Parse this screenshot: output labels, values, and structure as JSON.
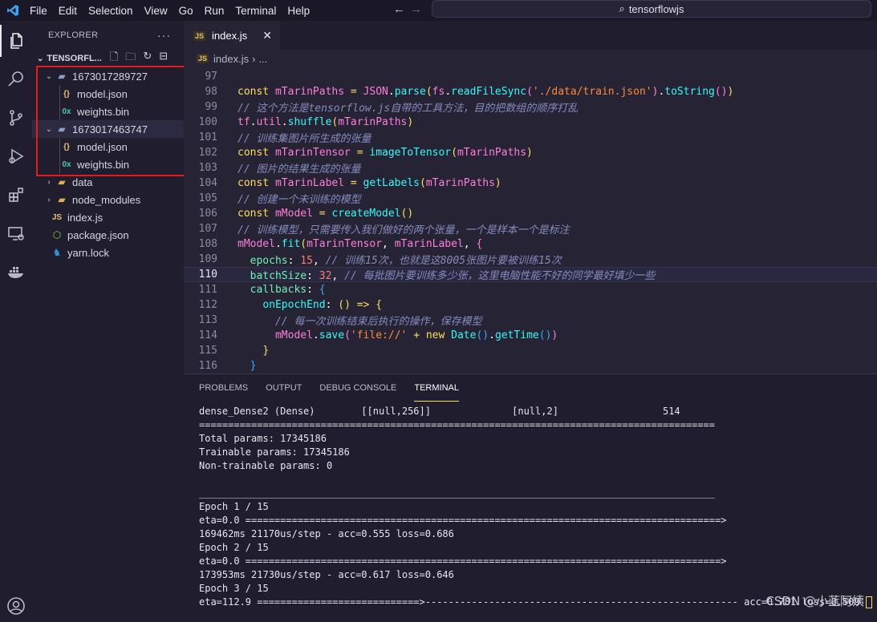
{
  "menu": [
    "File",
    "Edit",
    "Selection",
    "View",
    "Go",
    "Run",
    "Terminal",
    "Help"
  ],
  "search": {
    "text": "tensorflowjs"
  },
  "explorer": {
    "title": "EXPLORER",
    "more": "···",
    "root": "TENSORFL...",
    "items": [
      {
        "label": "1673017289727",
        "kind": "folder-open"
      },
      {
        "label": "model.json",
        "kind": "json"
      },
      {
        "label": "weights.bin",
        "kind": "bin"
      },
      {
        "label": "1673017463747",
        "kind": "folder-open"
      },
      {
        "label": "model.json",
        "kind": "json"
      },
      {
        "label": "weights.bin",
        "kind": "bin"
      },
      {
        "label": "data",
        "kind": "folder"
      },
      {
        "label": "node_modules",
        "kind": "folder"
      },
      {
        "label": "index.js",
        "kind": "js"
      },
      {
        "label": "package.json",
        "kind": "npm"
      },
      {
        "label": "yarn.lock",
        "kind": "yarn"
      }
    ]
  },
  "editor": {
    "tab": "index.js",
    "breadcrumb": "index.js",
    "breadcrumb_rest": "...",
    "lines": [
      {
        "n": "97",
        "html": ""
      },
      {
        "n": "98",
        "html": "<span class='kw'>const</span> <span class='var'>mTarinPaths</span> <span class='kw'>=</span> <span class='var'>JSON</span>.<span class='fn'>parse</span><span class='br'>(</span><span class='var'>fs</span>.<span class='fn'>readFileSync</span><span class='br2'>(</span><span class='str'>'./data/train.json'</span><span class='br2'>)</span>.<span class='fn'>toString</span><span class='br2'>()</span><span class='br'>)</span>"
      },
      {
        "n": "99",
        "html": "<span class='cm'>// 这个方法是tensorflow.js自带的工具方法，目的把数组的顺序打乱</span>"
      },
      {
        "n": "100",
        "html": "<span class='var'>tf</span>.<span class='var'>util</span>.<span class='fn'>shuffle</span><span class='br'>(</span><span class='var'>mTarinPaths</span><span class='br'>)</span>"
      },
      {
        "n": "101",
        "html": "<span class='cm'>// 训练集图片所生成的张量</span>"
      },
      {
        "n": "102",
        "html": "<span class='kw'>const</span> <span class='var'>mTarinTensor</span> <span class='kw'>=</span> <span class='fn'>imageToTensor</span><span class='br'>(</span><span class='var'>mTarinPaths</span><span class='br'>)</span>"
      },
      {
        "n": "103",
        "html": "<span class='cm'>// 图片的结果生成的张量</span>"
      },
      {
        "n": "104",
        "html": "<span class='kw'>const</span> <span class='var'>mTarinLabel</span> <span class='kw'>=</span> <span class='fn'>getLabels</span><span class='br'>(</span><span class='var'>mTarinPaths</span><span class='br'>)</span>"
      },
      {
        "n": "105",
        "html": "<span class='cm'>// 创建一个未训练的模型</span>"
      },
      {
        "n": "106",
        "html": "<span class='kw'>const</span> <span class='var'>mModel</span> <span class='kw'>=</span> <span class='fn'>createModel</span><span class='br'>()</span>"
      },
      {
        "n": "107",
        "html": "<span class='cm'>// 训练模型，只需要传入我们做好的两个张量，一个是样本一个是标注</span>"
      },
      {
        "n": "108",
        "html": "<span class='var'>mModel</span>.<span class='fn'>fit</span><span class='br'>(</span><span class='var'>mTarinTensor</span>, <span class='var'>mTarinLabel</span>, <span class='br2'>{</span>"
      },
      {
        "n": "109",
        "html": "  <span class='prop'>epochs</span>: <span class='num'>15</span>, <span class='cm'>// 训练15次，也就是这8005张图片要被训练15次</span>"
      },
      {
        "n": "110",
        "html": "  <span class='prop'>batchSize</span>: <span class='num'>32</span>, <span class='cm'>// 每批图片要训练多少张，这里电脑性能不好的同学最好填少一些</span>"
      },
      {
        "n": "111",
        "html": "  <span class='prop'>callbacks</span>: <span class='br3'>{</span>"
      },
      {
        "n": "112",
        "html": "    <span class='fn'>onEpochEnd</span>: <span class='br'>()</span> <span class='kw'>=&gt;</span> <span class='br'>{</span>"
      },
      {
        "n": "113",
        "html": "      <span class='cm'>// 每一次训练结束后执行的操作，保存模型</span>"
      },
      {
        "n": "114",
        "html": "      <span class='var'>mModel</span>.<span class='fn'>save</span><span class='br2'>(</span><span class='str'>'file://'</span> <span class='kw'>+</span> <span class='kw'>new</span> <span class='fn'>Date</span><span class='br3'>()</span>.<span class='fn'>getTime</span><span class='br3'>()</span><span class='br2'>)</span>"
      },
      {
        "n": "115",
        "html": "    <span class='br'>}</span>"
      },
      {
        "n": "116",
        "html": "  <span class='br3'>}</span>"
      }
    ],
    "current_line": "110"
  },
  "panel": {
    "tabs": [
      "PROBLEMS",
      "OUTPUT",
      "DEBUG CONSOLE",
      "TERMINAL"
    ],
    "active_tab": "TERMINAL",
    "terminal_lines": [
      "dense_Dense2 (Dense)        [[null,256]]              [null,2]                  514",
      "=========================================================================================",
      "Total params: 17345186",
      "Trainable params: 17345186",
      "Non-trainable params: 0",
      "",
      "_________________________________________________________________________________________",
      "Epoch 1 / 15",
      "eta=0.0 ==================================================================================>",
      "169462ms 21170us/step - acc=0.555 loss=0.686",
      "Epoch 2 / 15",
      "eta=0.0 ==================================================================================>",
      "173953ms 21730us/step - acc=0.617 loss=0.646",
      "Epoch 3 / 15",
      "eta=112.9 ============================>------------------------------------------------------ acc=0.781 loss=0.509 "
    ]
  },
  "watermark": "CSDN @小蓝阿姨"
}
